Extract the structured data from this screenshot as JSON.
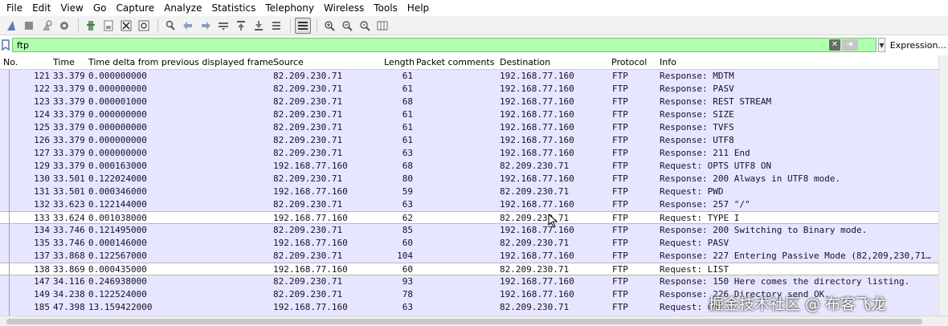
{
  "menu": [
    "File",
    "Edit",
    "View",
    "Go",
    "Capture",
    "Analyze",
    "Statistics",
    "Telephony",
    "Wireless",
    "Tools",
    "Help"
  ],
  "toolbar_icons": [
    "shark-fin-start-icon",
    "stop-square-icon",
    "restart-fin-icon",
    "options-gear-icon",
    "open-file-icon",
    "save-file-icon",
    "close-file-icon",
    "reload-icon",
    "find-magnifier-icon",
    "back-arrow-icon",
    "forward-arrow-icon",
    "go-to-packet-icon",
    "first-packet-icon",
    "last-packet-icon",
    "autoscroll-icon",
    "colorize-icon",
    "zoom-in-icon",
    "zoom-out-icon",
    "zoom-normal-icon",
    "resize-columns-icon"
  ],
  "filter": {
    "value": "ftp",
    "expression_label": "Expression..."
  },
  "columns": {
    "no": "No.",
    "time": "Time",
    "delta": "Time delta from previous displayed frame",
    "source": "Source",
    "length": "Length",
    "comments": "Packet comments",
    "destination": "Destination",
    "protocol": "Protocol",
    "info": "Info"
  },
  "packets": [
    {
      "no": "121",
      "time": "33.379",
      "delta": "0.000000000",
      "src": "82.209.230.71",
      "len": "61",
      "dst": "192.168.77.160",
      "proto": "FTP",
      "info": "Response:  MDTM"
    },
    {
      "no": "122",
      "time": "33.379",
      "delta": "0.000000000",
      "src": "82.209.230.71",
      "len": "61",
      "dst": "192.168.77.160",
      "proto": "FTP",
      "info": "Response:  PASV"
    },
    {
      "no": "123",
      "time": "33.379",
      "delta": "0.000001000",
      "src": "82.209.230.71",
      "len": "68",
      "dst": "192.168.77.160",
      "proto": "FTP",
      "info": "Response:  REST STREAM"
    },
    {
      "no": "124",
      "time": "33.379",
      "delta": "0.000000000",
      "src": "82.209.230.71",
      "len": "61",
      "dst": "192.168.77.160",
      "proto": "FTP",
      "info": "Response:  SIZE"
    },
    {
      "no": "125",
      "time": "33.379",
      "delta": "0.000000000",
      "src": "82.209.230.71",
      "len": "61",
      "dst": "192.168.77.160",
      "proto": "FTP",
      "info": "Response:  TVFS"
    },
    {
      "no": "126",
      "time": "33.379",
      "delta": "0.000000000",
      "src": "82.209.230.71",
      "len": "61",
      "dst": "192.168.77.160",
      "proto": "FTP",
      "info": "Response:  UTF8"
    },
    {
      "no": "127",
      "time": "33.379",
      "delta": "0.000000000",
      "src": "82.209.230.71",
      "len": "63",
      "dst": "192.168.77.160",
      "proto": "FTP",
      "info": "Response: 211 End"
    },
    {
      "no": "129",
      "time": "33.379",
      "delta": "0.000163000",
      "src": "192.168.77.160",
      "len": "68",
      "dst": "82.209.230.71",
      "proto": "FTP",
      "info": "Request: OPTS UTF8 ON"
    },
    {
      "no": "130",
      "time": "33.501",
      "delta": "0.122024000",
      "src": "82.209.230.71",
      "len": "80",
      "dst": "192.168.77.160",
      "proto": "FTP",
      "info": "Response: 200 Always in UTF8 mode."
    },
    {
      "no": "131",
      "time": "33.501",
      "delta": "0.000346000",
      "src": "192.168.77.160",
      "len": "59",
      "dst": "82.209.230.71",
      "proto": "FTP",
      "info": "Request: PWD"
    },
    {
      "no": "132",
      "time": "33.623",
      "delta": "0.122144000",
      "src": "82.209.230.71",
      "len": "63",
      "dst": "192.168.77.160",
      "proto": "FTP",
      "info": "Response: 257 \"/\""
    },
    {
      "no": "133",
      "time": "33.624",
      "delta": "0.001038000",
      "src": "192.168.77.160",
      "len": "62",
      "dst": "82.209.230.71",
      "proto": "FTP",
      "info": "Request: TYPE I"
    },
    {
      "no": "134",
      "time": "33.746",
      "delta": "0.121495000",
      "src": "82.209.230.71",
      "len": "85",
      "dst": "192.168.77.160",
      "proto": "FTP",
      "info": "Response: 200 Switching to Binary mode."
    },
    {
      "no": "135",
      "time": "33.746",
      "delta": "0.000146000",
      "src": "192.168.77.160",
      "len": "60",
      "dst": "82.209.230.71",
      "proto": "FTP",
      "info": "Request: PASV"
    },
    {
      "no": "137",
      "time": "33.868",
      "delta": "0.122567000",
      "src": "82.209.230.71",
      "len": "104",
      "dst": "192.168.77.160",
      "proto": "FTP",
      "info": "Response: 227 Entering Passive Mode (82,209,230,71…"
    },
    {
      "no": "138",
      "time": "33.869",
      "delta": "0.000435000",
      "src": "192.168.77.160",
      "len": "60",
      "dst": "82.209.230.71",
      "proto": "FTP",
      "info": "Request: LIST"
    },
    {
      "no": "147",
      "time": "34.116",
      "delta": "0.246938000",
      "src": "82.209.230.71",
      "len": "93",
      "dst": "192.168.77.160",
      "proto": "FTP",
      "info": "Response: 150 Here comes the directory listing."
    },
    {
      "no": "149",
      "time": "34.238",
      "delta": "0.122524000",
      "src": "82.209.230.71",
      "len": "78",
      "dst": "192.168.77.160",
      "proto": "FTP",
      "info": "Response: 226 Directory send OK."
    },
    {
      "no": "185",
      "time": "47.398",
      "delta": "13.159422000",
      "src": "192.168.77.160",
      "len": "63",
      "dst": "82.209.230.71",
      "proto": "FTP",
      "info": "Request: CWD /"
    }
  ],
  "selected_rows": [
    "133",
    "138"
  ],
  "watermark": "掘金技术社区 @ 布客飞龙",
  "colors": {
    "row_background": "#e7e6ff",
    "filter_valid": "#afffaf"
  }
}
